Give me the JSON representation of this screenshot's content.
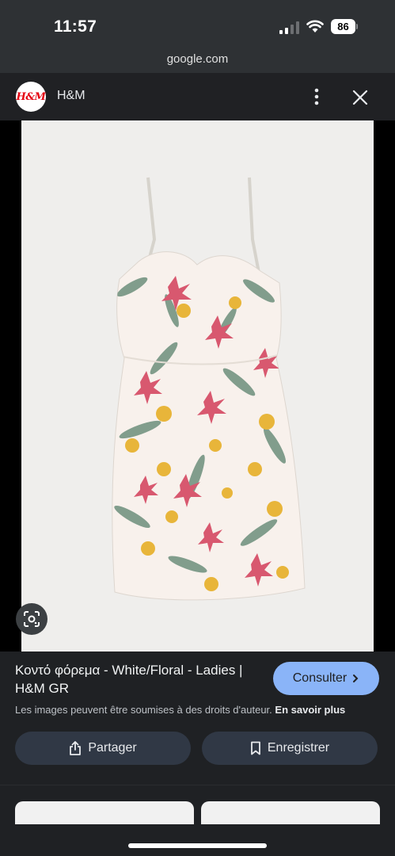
{
  "status_bar": {
    "time": "11:57",
    "battery": "86"
  },
  "browser": {
    "url": "google.com"
  },
  "site": {
    "logo_text": "H&M",
    "name": "H&M"
  },
  "result": {
    "title": "Κοντό φόρεμα - White/Floral - Ladies | H&M GR",
    "consult_label": "Consulter",
    "copyright_text": "Les images peuvent être soumises à des droits d'auteur.",
    "learn_more": "En savoir plus",
    "share_label": "Partager",
    "save_label": "Enregistrer"
  },
  "colors": {
    "accent": "#8ab4f8",
    "background": "#1f2124",
    "button": "#303845"
  }
}
